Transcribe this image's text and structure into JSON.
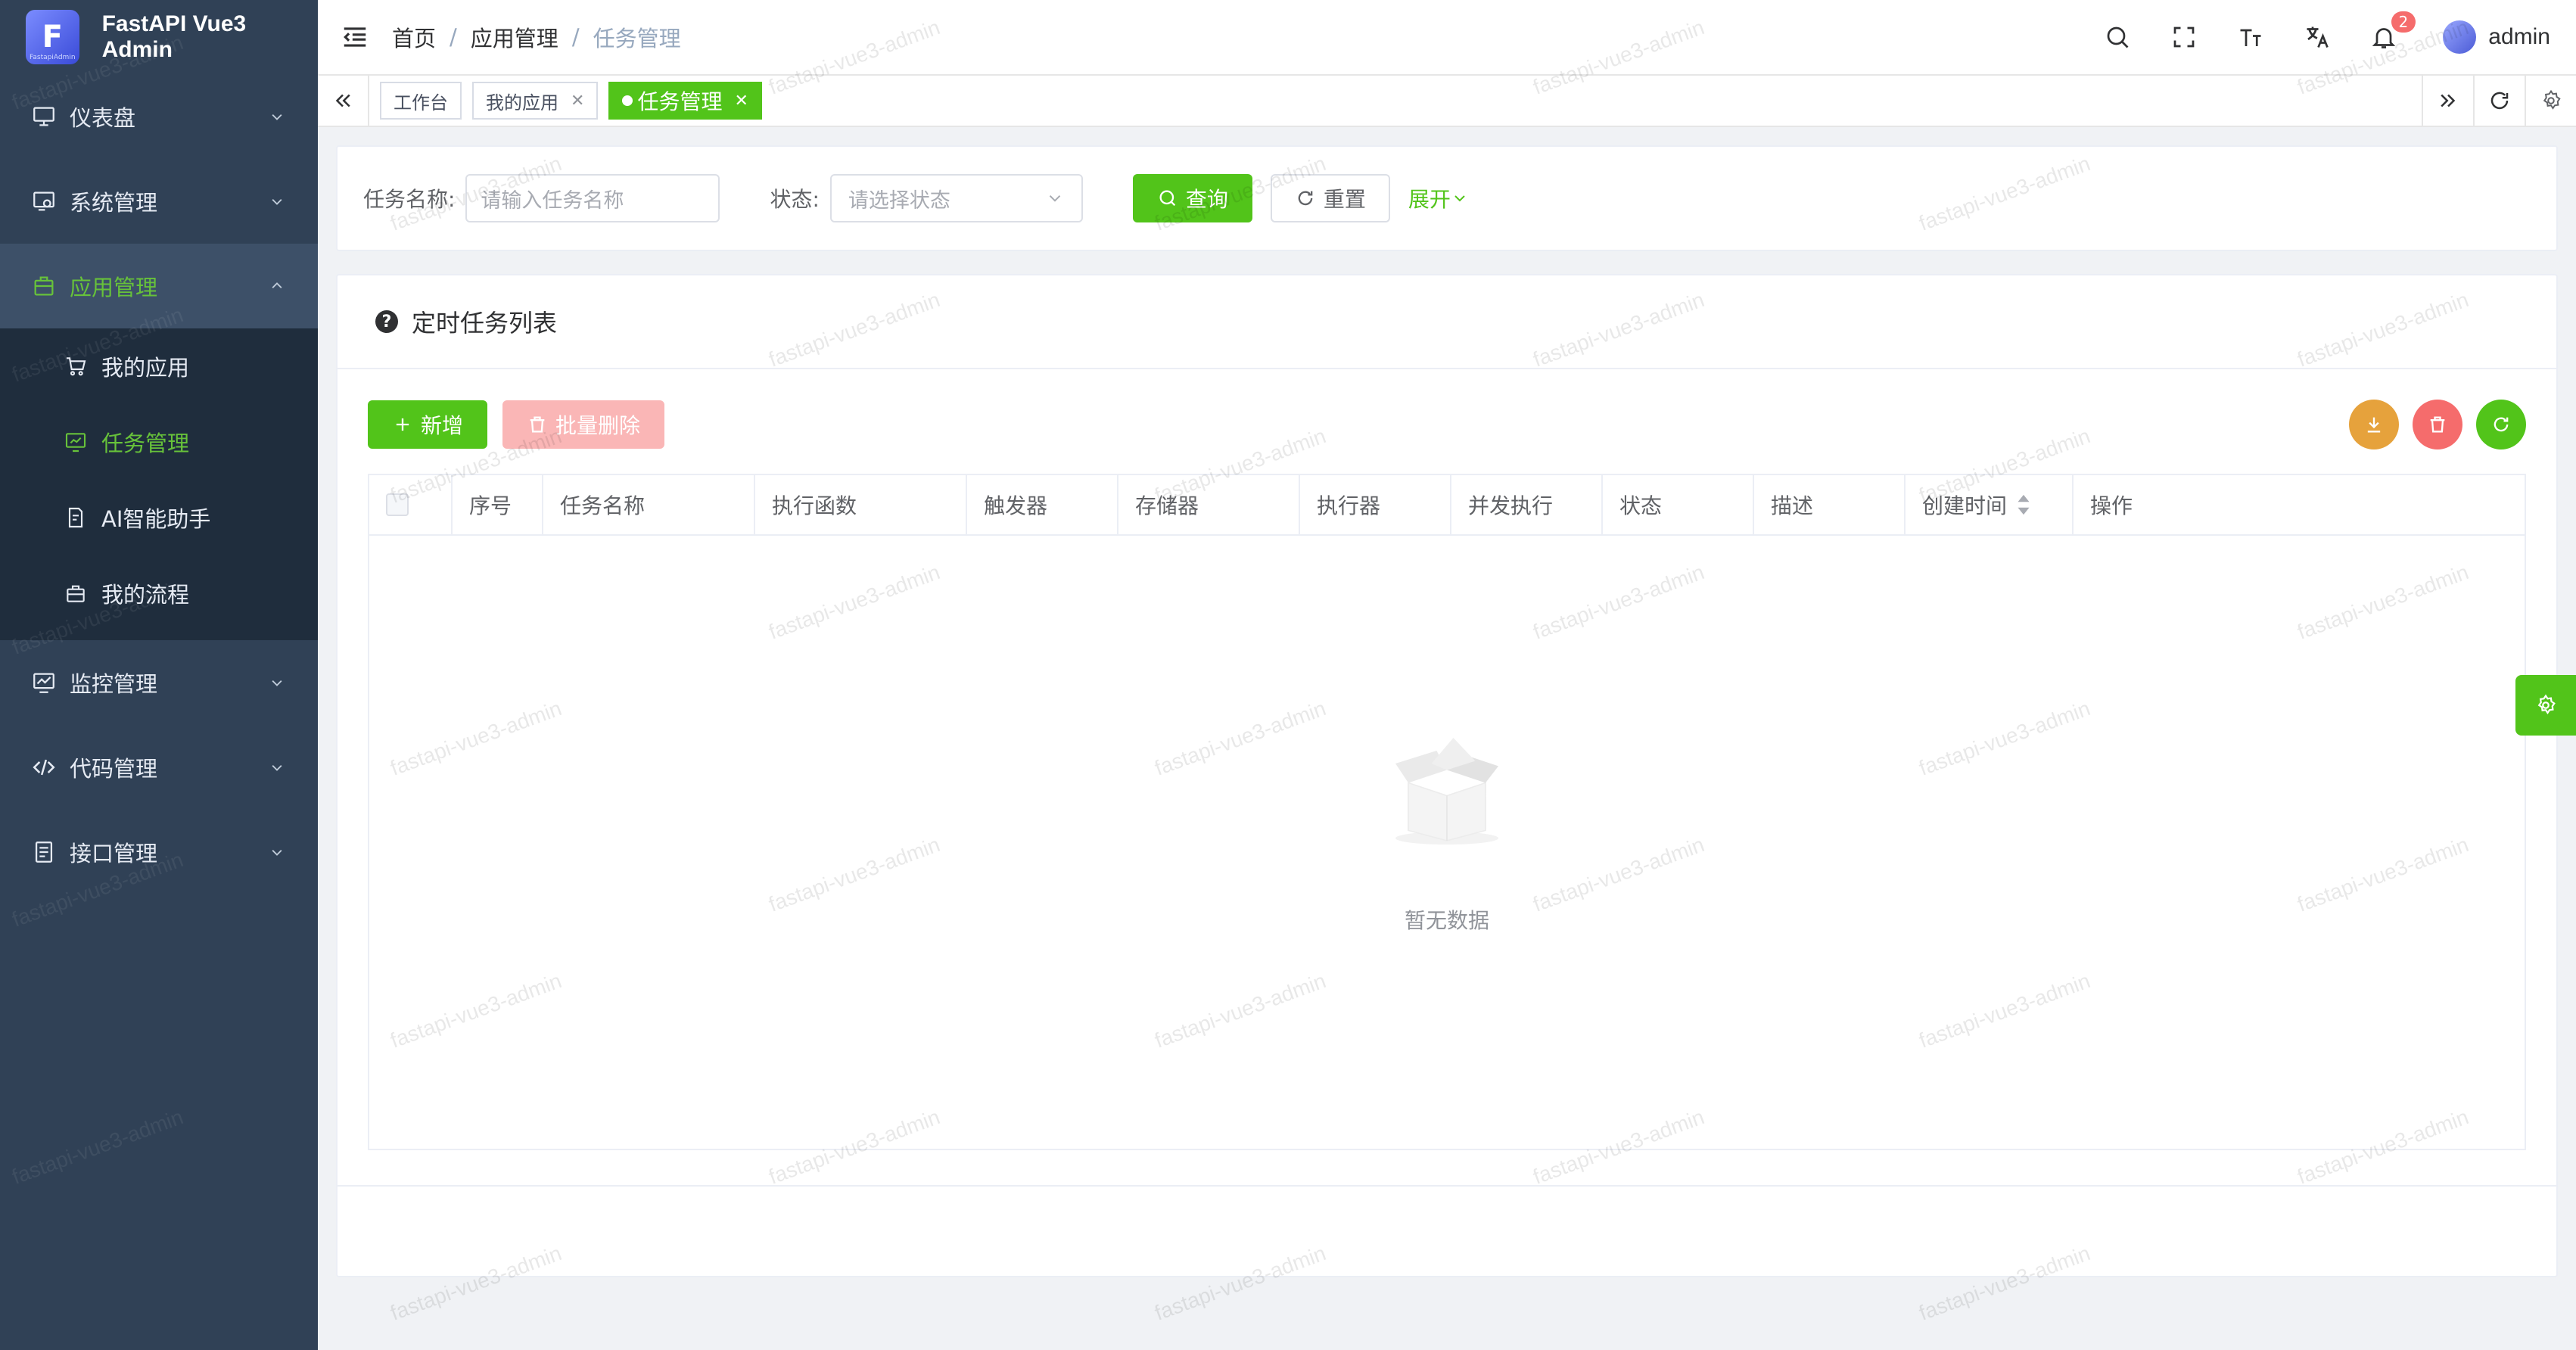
{
  "app": {
    "title": "FastAPI Vue3 Admin",
    "logo_caption": "FastapiAdmin"
  },
  "sidebar": {
    "items": [
      {
        "label": "仪表盘",
        "icon": "monitor-icon"
      },
      {
        "label": "系统管理",
        "icon": "settings-monitor-icon"
      },
      {
        "label": "应用管理",
        "icon": "briefcase-icon",
        "expanded": true,
        "children": [
          {
            "label": "我的应用",
            "icon": "cart-icon"
          },
          {
            "label": "任务管理",
            "icon": "chart-board-icon",
            "active": true
          },
          {
            "label": "AI智能助手",
            "icon": "document-icon"
          },
          {
            "label": "我的流程",
            "icon": "bag-icon"
          }
        ]
      },
      {
        "label": "监控管理",
        "icon": "monitor-chart-icon"
      },
      {
        "label": "代码管理",
        "icon": "code-icon"
      },
      {
        "label": "接口管理",
        "icon": "list-icon"
      }
    ]
  },
  "header": {
    "breadcrumb": [
      "首页",
      "应用管理",
      "任务管理"
    ],
    "breadcrumb_sep": "/",
    "notification_count": "2",
    "username": "admin"
  },
  "tabs": [
    {
      "label": "工作台",
      "closable": false
    },
    {
      "label": "我的应用",
      "closable": true
    },
    {
      "label": "任务管理",
      "closable": true,
      "active": true
    }
  ],
  "search": {
    "name_label": "任务名称:",
    "name_placeholder": "请输入任务名称",
    "status_label": "状态:",
    "status_placeholder": "请选择状态",
    "query_label": "查询",
    "reset_label": "重置",
    "expand_label": "展开"
  },
  "table_card": {
    "title": "定时任务列表",
    "add_label": "新增",
    "batch_delete_label": "批量删除",
    "columns": [
      "序号",
      "任务名称",
      "执行函数",
      "触发器",
      "存储器",
      "执行器",
      "并发执行",
      "状态",
      "描述",
      "创建时间",
      "操作"
    ],
    "empty_text": "暂无数据"
  },
  "watermark_text": "fastapi-vue3-admin",
  "colors": {
    "primary": "#52c41a",
    "sidebar_bg": "#304156",
    "danger": "#f56c6c",
    "warning": "#e6a23c"
  }
}
